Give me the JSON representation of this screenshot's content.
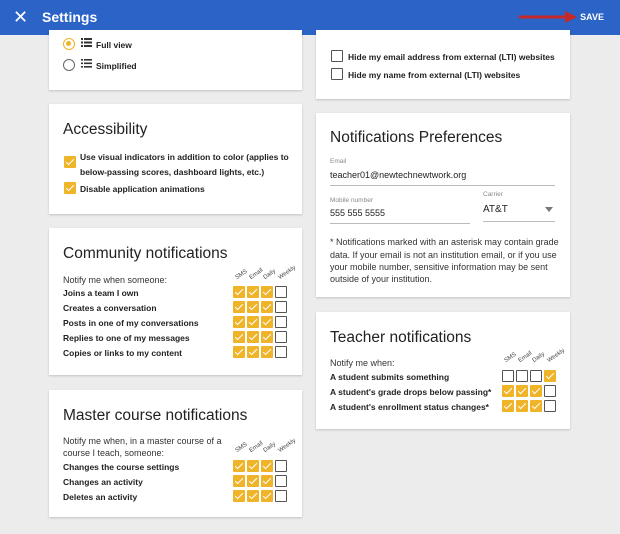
{
  "header": {
    "title": "Settings",
    "save_label": "SAVE",
    "close_glyph": "✕",
    "bg_color": "#2b63c6"
  },
  "view": {
    "full_label": "Full view",
    "simplified_label": "Simplified",
    "selected": "full"
  },
  "privacy": {
    "items": [
      {
        "label": "Hide my email address from external (LTI) websites",
        "checked": false
      },
      {
        "label": "Hide my name from external (LTI) websites",
        "checked": false
      }
    ]
  },
  "accessibility": {
    "title": "Accessibility",
    "items": [
      {
        "label_line1": "Use visual indicators in addition to color (applies to",
        "label_line2": "below-passing scores, dashboard lights, etc.)",
        "checked": true
      },
      {
        "label_line1": "Disable application animations",
        "checked": true
      }
    ]
  },
  "notif_prefs": {
    "title": "Notifications Preferences",
    "email_label": "Email",
    "email_value": "teacher01@newtechnewtwork.org",
    "mobile_label": "Mobile number",
    "mobile_value": "555 555 5555",
    "carrier_label": "Carrier",
    "carrier_value": "AT&T",
    "note_lines": [
      "* Notifications marked with an asterisk may contain grade",
      "data. If your email is not an institution email, or if you use",
      "your mobile number, sensitive information may be sent",
      "outside of your institution."
    ]
  },
  "channels": [
    "SMS",
    "Email",
    "Daily",
    "Weekly"
  ],
  "community": {
    "title": "Community notifications",
    "intro": "Notify me when someone:",
    "rows": [
      {
        "label": "Joins a team I own",
        "checks": [
          true,
          true,
          true,
          false
        ]
      },
      {
        "label": "Creates a conversation",
        "checks": [
          true,
          true,
          true,
          false
        ]
      },
      {
        "label": "Posts in one of my conversations",
        "checks": [
          true,
          true,
          true,
          false
        ]
      },
      {
        "label": "Replies to one of my messages",
        "checks": [
          true,
          true,
          true,
          false
        ]
      },
      {
        "label": "Copies or links to my content",
        "checks": [
          true,
          true,
          true,
          false
        ]
      }
    ]
  },
  "teacher": {
    "title": "Teacher notifications",
    "intro": "Notify me when:",
    "rows": [
      {
        "label": "A student submits something",
        "checks": [
          false,
          false,
          false,
          true
        ]
      },
      {
        "label": "A student's grade drops below passing*",
        "checks": [
          true,
          true,
          true,
          false
        ]
      },
      {
        "label": "A student's enrollment status changes*",
        "checks": [
          true,
          true,
          true,
          false
        ]
      }
    ]
  },
  "master": {
    "title": "Master course notifications",
    "intro_line1": "Notify me when, in a master course of a",
    "intro_line2": "course I teach, someone:",
    "rows": [
      {
        "label": "Changes the course settings",
        "checks": [
          true,
          true,
          true,
          false
        ]
      },
      {
        "label": "Changes an activity",
        "checks": [
          true,
          true,
          true,
          false
        ]
      },
      {
        "label": "Deletes an activity",
        "checks": [
          true,
          true,
          true,
          false
        ]
      }
    ]
  },
  "colors": {
    "accent": "#f0b429",
    "arrow": "#c62828"
  }
}
